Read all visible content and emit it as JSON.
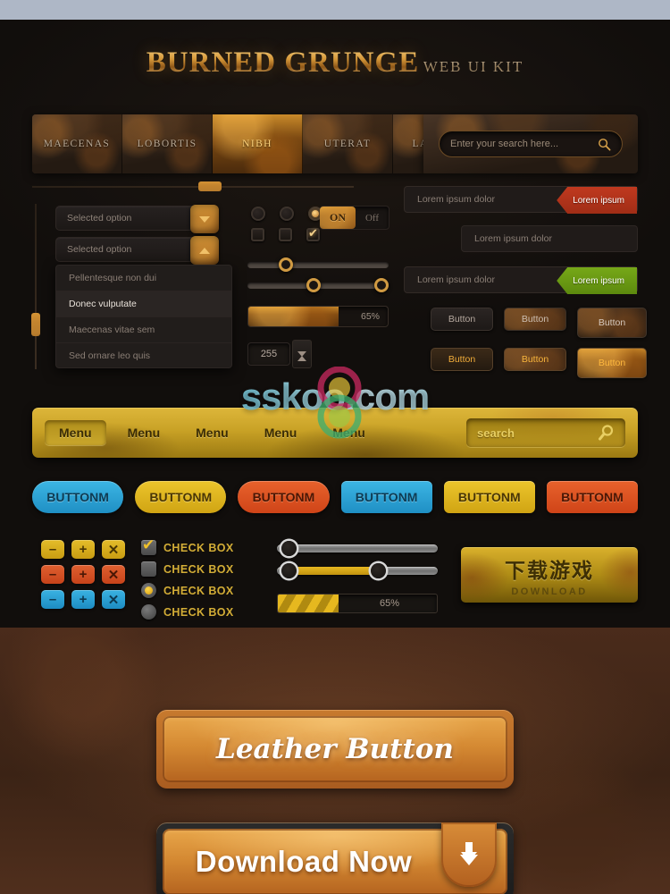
{
  "brand": {
    "title": "BURNED GRUNGE",
    "subtitle": "WEB UI KIT",
    "accent_gold": "#d79a3c",
    "accent_amber": "#ffd37a"
  },
  "topbar_color": "#aeb7c6",
  "nav": {
    "items": [
      {
        "label": "MAECENAS",
        "active": false
      },
      {
        "label": "LOBORTIS",
        "active": false
      },
      {
        "label": "NIBH",
        "active": true
      },
      {
        "label": "UTERAT",
        "active": false
      },
      {
        "label": "LACINIA",
        "active": false
      }
    ],
    "search_placeholder": "Enter your search here...",
    "search_icon": "magnifier-icon"
  },
  "selects": {
    "closed_value": "Selected option",
    "open_value": "Selected option",
    "closed_icon": "chevron-down-icon",
    "open_icon": "chevron-up-icon",
    "options": [
      {
        "label": "Pellentesque non dui",
        "selected": false
      },
      {
        "label": "Donec vulputate",
        "selected": true
      },
      {
        "label": "Maecenas vitae sem",
        "selected": false
      },
      {
        "label": "Sed ornare leo quis",
        "selected": false
      }
    ]
  },
  "controls": {
    "radios": [
      {
        "checked": false
      },
      {
        "checked": false
      },
      {
        "checked": true
      }
    ],
    "checkboxes": [
      {
        "checked": false
      },
      {
        "checked": false
      },
      {
        "checked": true
      }
    ],
    "toggle": {
      "on_label": "ON",
      "off_label": "Off",
      "state": "on"
    },
    "slider_single": {
      "value": 28,
      "min": 0,
      "max": 100
    },
    "slider_range": {
      "low": 46,
      "high": 98,
      "min": 0,
      "max": 100
    },
    "progress": {
      "percent": 65,
      "label": "65%"
    },
    "spinner": {
      "value": "255",
      "up_icon": "caret-up-icon",
      "down_icon": "caret-down-icon"
    }
  },
  "validation": {
    "rows": [
      {
        "value": "Lorem ipsum dolor",
        "tag": "Lorem ipsum",
        "state": "error",
        "color": "#c0391f"
      },
      {
        "value": "Lorem ipsum dolor",
        "tag": "",
        "state": "plain",
        "color": ""
      },
      {
        "value": "Lorem ipsum dolor",
        "tag": "Lorem ipsum",
        "state": "success",
        "color": "#76a818"
      }
    ]
  },
  "button_grid": {
    "labels": [
      "Button",
      "Button",
      "Button",
      "Button",
      "Button",
      "Button"
    ]
  },
  "goldbar": {
    "menu_items": [
      {
        "label": "Menu",
        "active": true
      },
      {
        "label": "Menu",
        "active": false
      },
      {
        "label": "Menu",
        "active": false
      },
      {
        "label": "Menu",
        "active": false
      },
      {
        "label": "Menu",
        "active": false
      }
    ],
    "search_placeholder": "search",
    "search_icon": "magnifier-icon"
  },
  "buttonm": {
    "row1": [
      {
        "label": "BUTTONM",
        "color": "blue",
        "shape": "pill"
      },
      {
        "label": "BUTTONM",
        "color": "yellow",
        "shape": "pill"
      },
      {
        "label": "BUTTONM",
        "color": "orange",
        "shape": "pill"
      }
    ],
    "row2": [
      {
        "label": "BUTTONM",
        "color": "blue",
        "shape": "rect"
      },
      {
        "label": "BUTTONM",
        "color": "yellow",
        "shape": "rect"
      },
      {
        "label": "BUTTONM",
        "color": "orange",
        "shape": "rect"
      }
    ]
  },
  "icon_buttons": {
    "rows": [
      {
        "color": "yellow",
        "icons": [
          "minus-icon",
          "plus-icon",
          "close-icon"
        ],
        "glyphs": [
          "–",
          "+",
          "✕"
        ]
      },
      {
        "color": "orange",
        "icons": [
          "minus-icon",
          "plus-icon",
          "close-icon"
        ],
        "glyphs": [
          "–",
          "+",
          "✕"
        ]
      },
      {
        "color": "blue",
        "icons": [
          "minus-icon",
          "plus-icon",
          "close-icon"
        ],
        "glyphs": [
          "–",
          "+",
          "✕"
        ]
      }
    ]
  },
  "checkbox_list": [
    {
      "label": "CHECK BOX",
      "type": "square",
      "checked": true
    },
    {
      "label": "CHECK BOX",
      "type": "square",
      "checked": false
    },
    {
      "label": "CHECK BOX",
      "type": "circle",
      "checked": true
    },
    {
      "label": "CHECK BOX",
      "type": "circle",
      "checked": false
    }
  ],
  "metal_sliders": {
    "top": {
      "value": 7,
      "min": 0,
      "max": 100
    },
    "bottom": {
      "low": 7,
      "high": 62,
      "min": 0,
      "max": 100
    }
  },
  "stripe_progress": {
    "percent": 38,
    "label": "65%"
  },
  "download_button": {
    "primary": "下载游戏",
    "secondary": "DOWNLOAD"
  },
  "leather": {
    "button_1": {
      "label": "Leather Button"
    },
    "button_2": {
      "label": "Download Now",
      "icon": "download-arrow-icon"
    }
  },
  "watermark": {
    "text": "sskoo.com",
    "logo": "sskoo-logo-icon"
  }
}
